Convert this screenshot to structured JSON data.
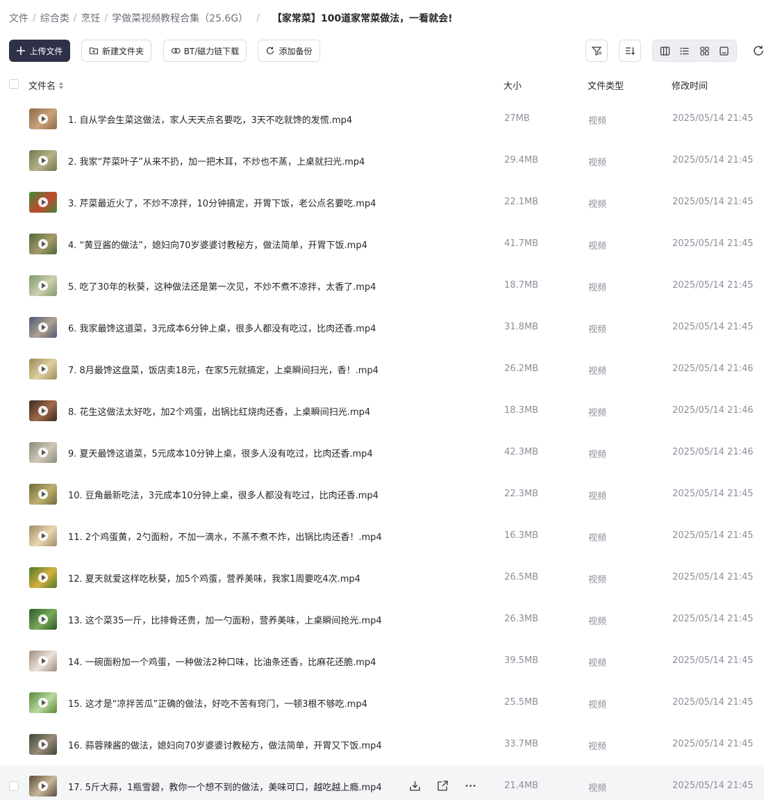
{
  "breadcrumb": {
    "items": [
      "文件",
      "综合类",
      "烹饪",
      "学做菜视频教程合集（25.6G）"
    ],
    "current": "【家常菜】100道家常菜做法，一看就会!"
  },
  "toolbar": {
    "upload_label": "上传文件",
    "mkdir_label": "新建文件夹",
    "bt_label": "BT/磁力链下载",
    "backup_label": "添加备份"
  },
  "table_header": {
    "name": "文件名",
    "size": "大小",
    "type": "文件类型",
    "modified": "修改时间"
  },
  "files": [
    {
      "name": "1. 自从学会生菜这做法，家人天天点名要吃，3天不吃就馋的发慌.mp4",
      "size": "27MB",
      "type": "视频",
      "modified": "2025/05/14 21:45",
      "thumb": [
        "#8a6a4a",
        "#c9a27a"
      ]
    },
    {
      "name": "2. 我家“芹菜叶子”从来不扔，加一把木耳，不炒也不蒸，上桌就扫光.mp4",
      "size": "29.4MB",
      "type": "视频",
      "modified": "2025/05/14 21:45",
      "thumb": [
        "#6b7a4a",
        "#b9b08a"
      ]
    },
    {
      "name": "3. 芹菜最近火了，不炒不凉拌，10分钟搞定，开胃下饭，老公点名要吃.mp4",
      "size": "22.1MB",
      "type": "视频",
      "modified": "2025/05/14 21:45",
      "thumb": [
        "#3f8a3a",
        "#c4472f"
      ]
    },
    {
      "name": "4. “黄豆酱的做法”，媳妇向70岁婆婆讨教秘方，做法简单，开胃下饭.mp4",
      "size": "41.7MB",
      "type": "视频",
      "modified": "2025/05/14 21:45",
      "thumb": [
        "#4a6a3a",
        "#a89a6a"
      ]
    },
    {
      "name": "5. 吃了30年的秋葵，这种做法还是第一次见，不炒不煮不凉拌，太香了.mp4",
      "size": "18.7MB",
      "type": "视频",
      "modified": "2025/05/14 21:45",
      "thumb": [
        "#7a9a6a",
        "#cfcfb0"
      ]
    },
    {
      "name": "6. 我家最馋这道菜，3元成本6分钟上桌，很多人都没有吃过，比肉还香.mp4",
      "size": "31.8MB",
      "type": "视频",
      "modified": "2025/05/14 21:45",
      "thumb": [
        "#4a5a7a",
        "#b0a090"
      ]
    },
    {
      "name": "7. 8月最馋这盘菜，饭店卖18元，在家5元就搞定，上桌瞬间扫光，香！.mp4",
      "size": "26.2MB",
      "type": "视频",
      "modified": "2025/05/14 21:46",
      "thumb": [
        "#9a8a5a",
        "#e0d0a0"
      ]
    },
    {
      "name": "8. 花生这做法太好吃，加2个鸡蛋，出锅比红烧肉还香，上桌瞬间扫光.mp4",
      "size": "18.3MB",
      "type": "视频",
      "modified": "2025/05/14 21:46",
      "thumb": [
        "#3a2a20",
        "#a06a4a"
      ]
    },
    {
      "name": "9. 夏天最馋这道菜，5元成本10分钟上桌，很多人没有吃过，比肉还香.mp4",
      "size": "42.3MB",
      "type": "视频",
      "modified": "2025/05/14 21:46",
      "thumb": [
        "#8a8a7a",
        "#d0c8b8"
      ]
    },
    {
      "name": "10. 豆角最新吃法，3元成本10分钟上桌，很多人都没有吃过，比肉还香.mp4",
      "size": "22.3MB",
      "type": "视频",
      "modified": "2025/05/14 21:45",
      "thumb": [
        "#6a6a3a",
        "#c0b070"
      ]
    },
    {
      "name": "11. 2个鸡蛋黄，2勺面粉，不加一滴水，不蒸不煮不炸，出锅比肉还香！.mp4",
      "size": "16.3MB",
      "type": "视频",
      "modified": "2025/05/14 21:45",
      "thumb": [
        "#a08a6a",
        "#e8d8b0"
      ]
    },
    {
      "name": "12. 夏天就爱这样吃秋葵，加5个鸡蛋，营养美味，我家1周要吃4次.mp4",
      "size": "26.5MB",
      "type": "视频",
      "modified": "2025/05/14 21:45",
      "thumb": [
        "#4a7a2a",
        "#d8b040"
      ]
    },
    {
      "name": "13. 这个菜35一斤，比排骨还贵，加一勺面粉，营养美味，上桌瞬间抢光.mp4",
      "size": "26.3MB",
      "type": "视频",
      "modified": "2025/05/14 21:45",
      "thumb": [
        "#2a5a2a",
        "#7aaa5a"
      ]
    },
    {
      "name": "14. 一碗面粉加一个鸡蛋，一种做法2种口味，比油条还香，比麻花还脆.mp4",
      "size": "39.5MB",
      "type": "视频",
      "modified": "2025/05/14 21:45",
      "thumb": [
        "#a08a7a",
        "#ece4dc"
      ]
    },
    {
      "name": "15. 这才是“凉拌苦瓜”正确的做法，好吃不苦有窍门，一顿3根不够吃.mp4",
      "size": "25.5MB",
      "type": "视频",
      "modified": "2025/05/14 21:45",
      "thumb": [
        "#5a8a3a",
        "#b8d8a0"
      ]
    },
    {
      "name": "16. 蒜蓉辣酱的做法，媳妇向70岁婆婆讨教秘方，做法简单，开胃又下饭.mp4",
      "size": "33.7MB",
      "type": "视频",
      "modified": "2025/05/14 21:45",
      "thumb": [
        "#3a4a3a",
        "#9a8a7a"
      ]
    },
    {
      "name": "17. 5斤大蒜，1瓶雪碧，教你一个想不到的做法，美味可口，越吃越上瘾.mp4",
      "size": "21.4MB",
      "type": "视频",
      "modified": "2025/05/14 21:45",
      "thumb": [
        "#5a4a3a",
        "#c8b898"
      ]
    }
  ],
  "hovered_row": 16,
  "colors": {
    "primary": "#2e3148",
    "muted": "#8c8f99",
    "hover_row": "#f4f5f7"
  }
}
